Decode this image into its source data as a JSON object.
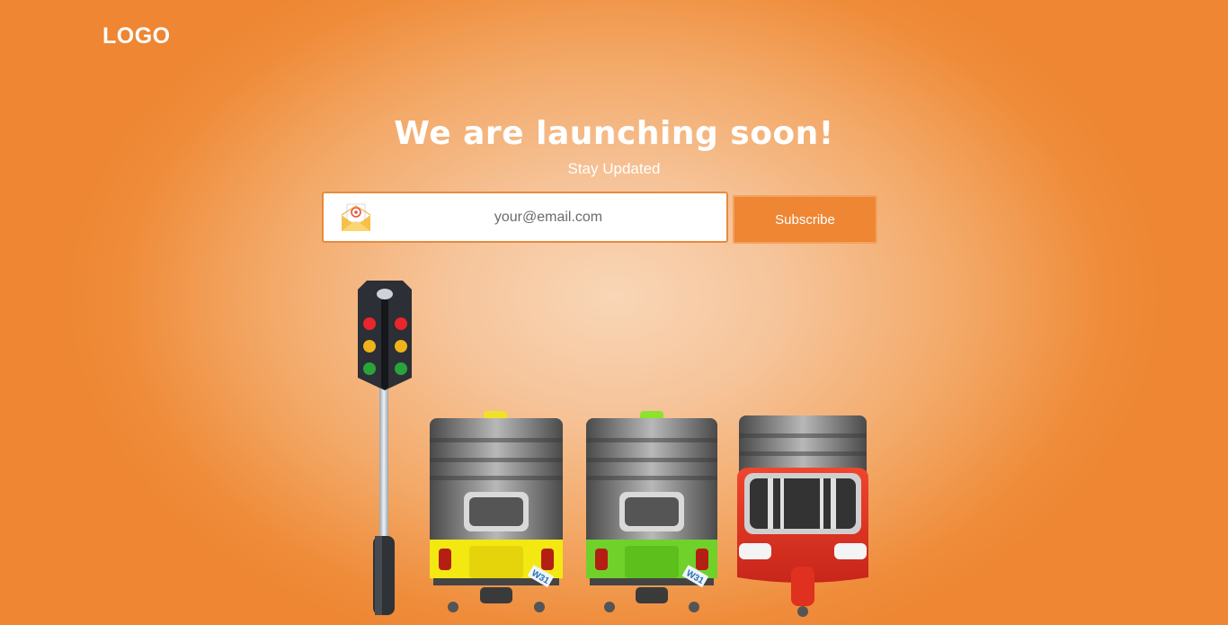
{
  "header": {
    "logo_text": "LOGO"
  },
  "hero": {
    "title": "We are launching soon!",
    "subtitle": "Stay Updated"
  },
  "subscribe_form": {
    "email_placeholder": "your@email.com",
    "email_value": "",
    "button_label": "Subscribe"
  },
  "illustration": {
    "items": [
      "traffic-light",
      "yellow-auto-rickshaw",
      "green-auto-rickshaw",
      "red-auto-rickshaw"
    ],
    "plate_text": "W31"
  },
  "colors": {
    "accent": "#ee8633",
    "background_center": "#f9d6b6",
    "background_edge": "#ee8633"
  }
}
